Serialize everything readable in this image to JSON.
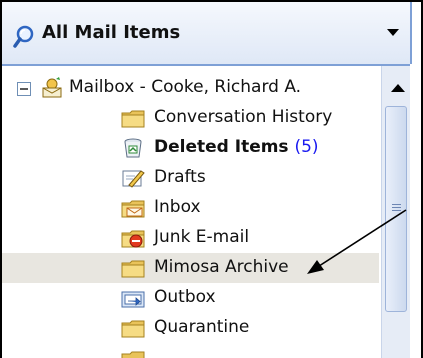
{
  "header": {
    "title": "All Mail Items",
    "search_icon": "search-icon",
    "dropdown_icon": "triangle-down-icon"
  },
  "tree": {
    "root": {
      "label": "Mailbox - Cooke, Richard A.",
      "expanded": true
    },
    "items": [
      {
        "label": "Conversation History",
        "icon": "folder-icon",
        "bold": false,
        "selected": false
      },
      {
        "label": "Deleted Items",
        "count": "(5)",
        "icon": "recycle-bin-icon",
        "bold": true,
        "selected": false
      },
      {
        "label": "Drafts",
        "icon": "drafts-pencil-icon",
        "bold": false,
        "selected": false
      },
      {
        "label": "Inbox",
        "icon": "inbox-icon",
        "bold": false,
        "selected": false
      },
      {
        "label": "Junk E-mail",
        "icon": "junk-mail-icon",
        "bold": false,
        "selected": false
      },
      {
        "label": "Mimosa Archive",
        "icon": "folder-icon",
        "bold": false,
        "selected": true
      },
      {
        "label": "Outbox",
        "icon": "outbox-icon",
        "bold": false,
        "selected": false
      },
      {
        "label": "Quarantine",
        "icon": "folder-icon",
        "bold": false,
        "selected": false
      }
    ]
  },
  "colors": {
    "header_border": "#7ea0d6",
    "selection": "#e8e6e0",
    "count": "#1a1af0",
    "arrow": "#000000"
  }
}
